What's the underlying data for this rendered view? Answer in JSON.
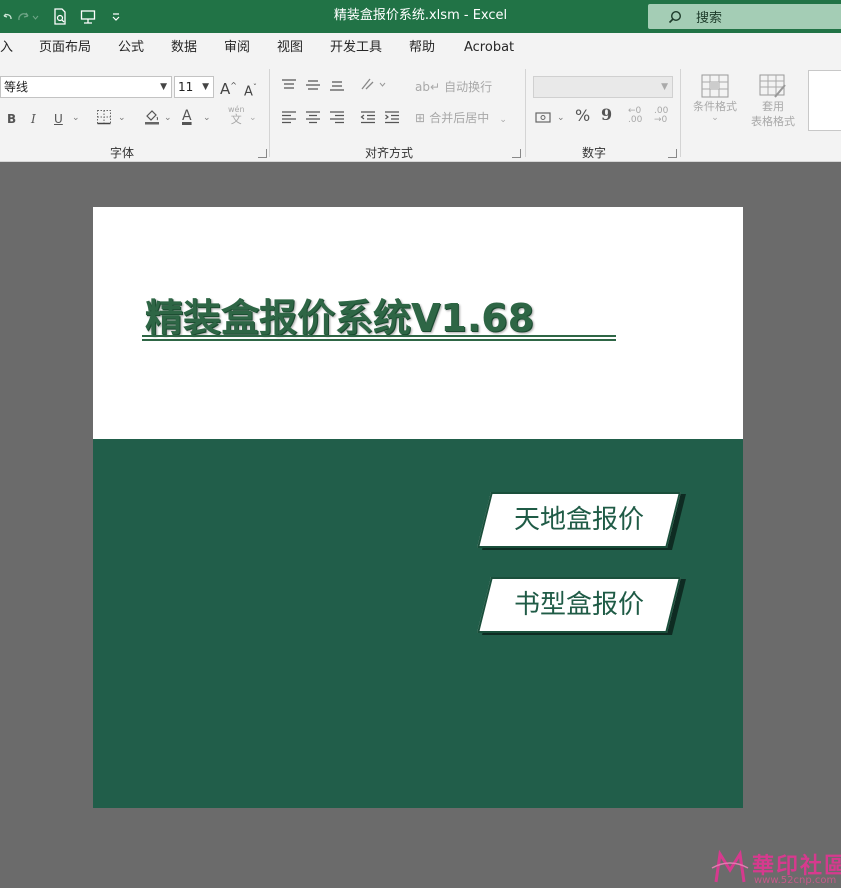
{
  "titlebar": {
    "document_title": "精装盒报价系统.xlsm  -  Excel",
    "search_placeholder": "搜索"
  },
  "menu": {
    "tabs": [
      "入",
      "页面布局",
      "公式",
      "数据",
      "审阅",
      "视图",
      "开发工具",
      "帮助",
      "Acrobat"
    ]
  },
  "ribbon": {
    "font_name": "等线",
    "font_size": "11",
    "bold": "B",
    "italic": "I",
    "underline": "U",
    "font_color": "A",
    "phonetic_top": "wén",
    "phonetic_bottom": "文",
    "grow_font": "A",
    "shrink_font": "A",
    "wrap_text": "自动换行",
    "merge_center": "合并后居中",
    "percent": "%",
    "comma": "9",
    "conditional_format": "条件格式",
    "format_table_line1": "套用",
    "format_table_line2": "表格格式",
    "group_font": "字体",
    "group_alignment": "对齐方式",
    "group_number": "数字"
  },
  "sheet": {
    "app_title": "精装盒报价系统V1.68",
    "buttons": [
      "天地盒报价",
      "书型盒报价"
    ]
  },
  "watermark": {
    "text": "華印社區",
    "url": "www.52cnp.com"
  },
  "colors": {
    "excel_green": "#217346",
    "panel_green": "#215e4a",
    "title_green": "#2e6645",
    "watermark_pink": "#d63a8e"
  }
}
